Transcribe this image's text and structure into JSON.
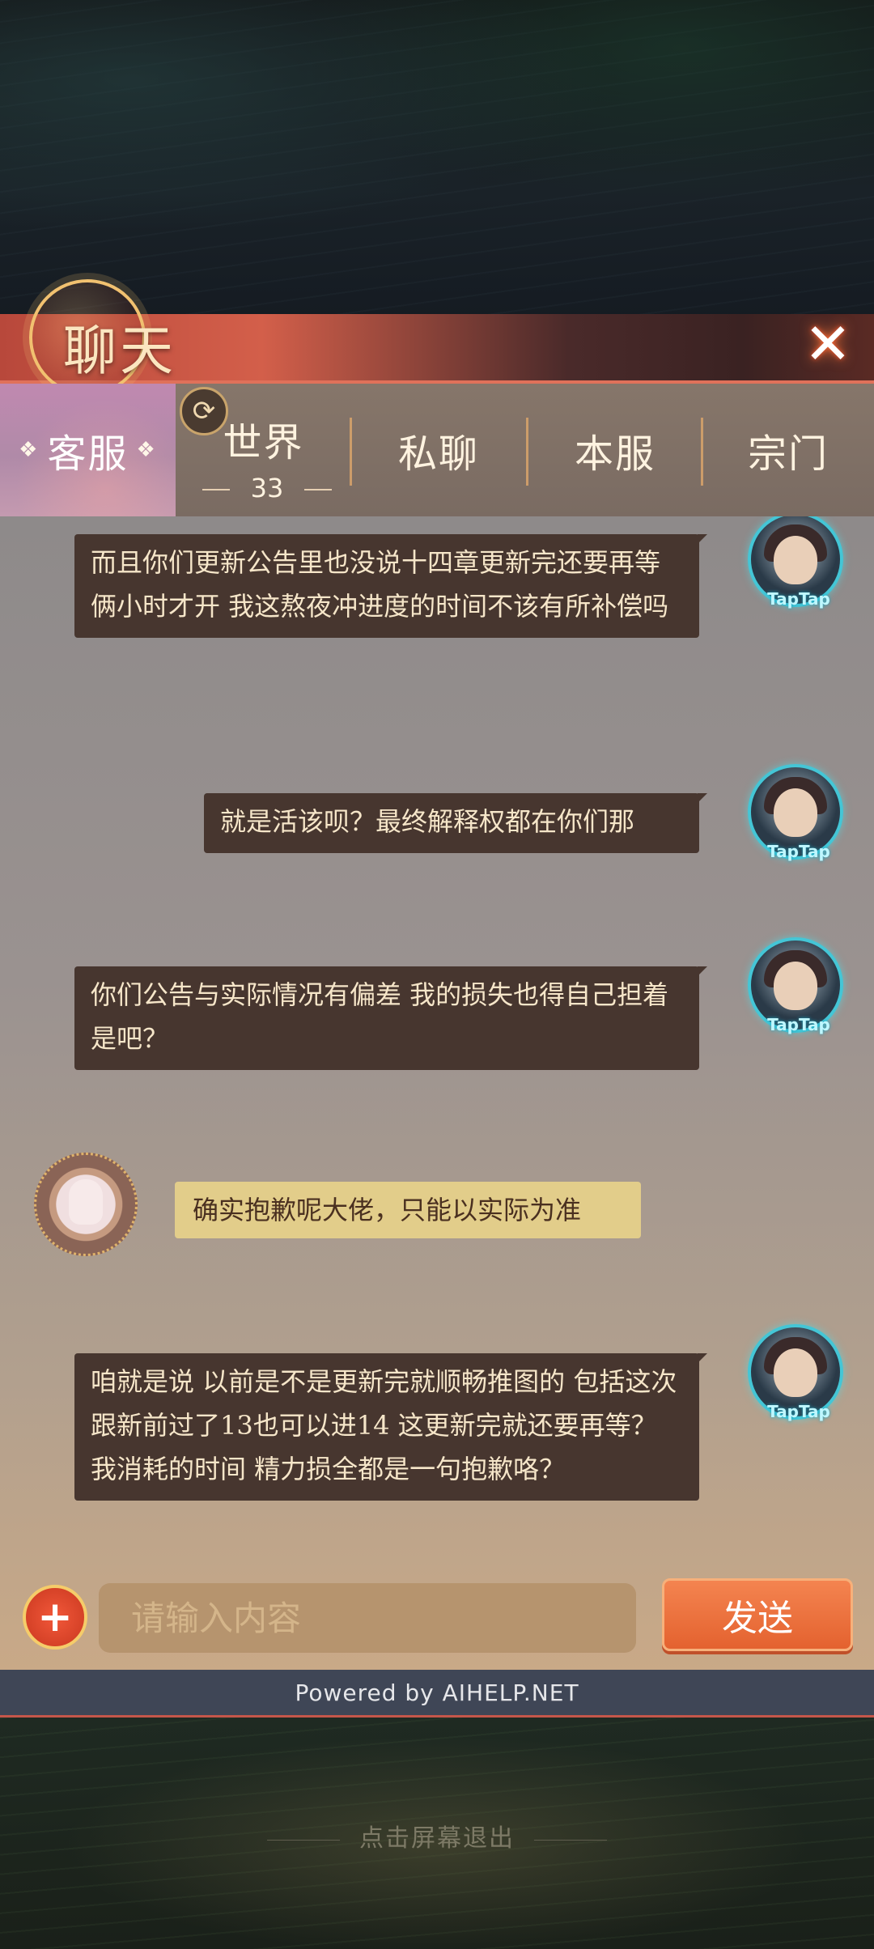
{
  "header": {
    "title": "聊天"
  },
  "tabs": [
    {
      "label": "客服",
      "active": true
    },
    {
      "label": "世界",
      "badge": "33"
    },
    {
      "label": "私聊"
    },
    {
      "label": "本服"
    },
    {
      "label": "宗门"
    }
  ],
  "messages": [
    {
      "sender": "user",
      "text": "而且你们更新公告里也没说十四章更新完还要再等俩小时才开 我这熬夜冲进度的时间不该有所补偿吗"
    },
    {
      "sender": "user",
      "text": "就是活该呗？最终解释权都在你们那"
    },
    {
      "sender": "user",
      "text": "你们公告与实际情况有偏差 我的损失也得自己担着是吧？"
    },
    {
      "sender": "support",
      "text": "确实抱歉呢大佬，只能以实际为准"
    },
    {
      "sender": "user",
      "text": "咱就是说 以前是不是更新完就顺畅推图的 包括这次跟新前过了13也可以进14 这更新完就还要再等？我消耗的时间 精力损全都是一句抱歉咯？"
    }
  ],
  "avatar_tag": "TapTap",
  "input": {
    "placeholder": "请输入内容",
    "send_label": "发送"
  },
  "powered_by": "Powered by AIHELP.NET",
  "exit_hint": "点击屏幕退出",
  "colors": {
    "user_bubble": "#47362f",
    "support_bubble": "#e2cd8a",
    "send_button": "#e4622f",
    "header_accent": "#d35f4a"
  }
}
